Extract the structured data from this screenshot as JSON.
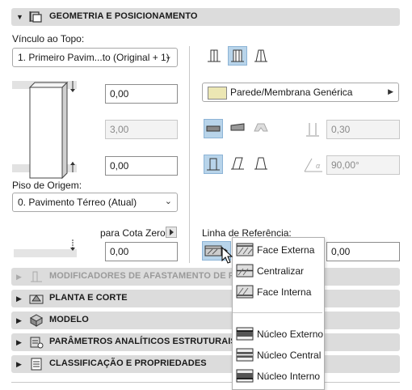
{
  "sections": {
    "geometry": {
      "title": "GEOMETRIA E POSICIONAMENTO",
      "expanded": true
    },
    "offset_modifiers": {
      "title": "MODIFICADORES DE AFASTAMENTO DE PE"
    },
    "plan_section": {
      "title": "PLANTA E CORTE"
    },
    "model": {
      "title": "MODELO"
    },
    "structural": {
      "title": "PARÂMETROS ANALÍTICOS ESTRUTURAIS"
    },
    "classification": {
      "title": "CLASSIFICAÇÃO E PROPRIEDADES"
    }
  },
  "geometry": {
    "top_link_label": "Vínculo ao Topo:",
    "top_link_value": "1. Primeiro Pavim...to (Original + 1)",
    "top_offset": "0,00",
    "height": "3,00",
    "bottom_offset": "0,00",
    "home_story_label": "Piso de Origem:",
    "home_story_value": "0. Pavimento Térreo (Atual)",
    "to_zero_label": "para Cota Zero",
    "to_zero_value": "0,00",
    "building_material": "Parede/Membrana Genérica",
    "thickness": "0,30",
    "angle": "90,00°",
    "ref_line_label": "Linha de Referência:",
    "ref_line_offset": "0,00"
  },
  "ref_line_menu": {
    "items": [
      {
        "label": "Face Externa",
        "icon": "face-outside-icon"
      },
      {
        "label": "Centralizar",
        "icon": "center-icon"
      },
      {
        "label": "Face Interna",
        "icon": "face-inside-icon"
      },
      {
        "label": "Núcleo Externo",
        "icon": "core-outside-icon"
      },
      {
        "label": "Núcleo Central",
        "icon": "core-center-icon"
      },
      {
        "label": "Núcleo Interno",
        "icon": "core-inside-icon"
      }
    ]
  },
  "colors": {
    "selected": "#b8d4ea",
    "header": "#dcdcdc",
    "material_swatch": "#ece7b4"
  }
}
